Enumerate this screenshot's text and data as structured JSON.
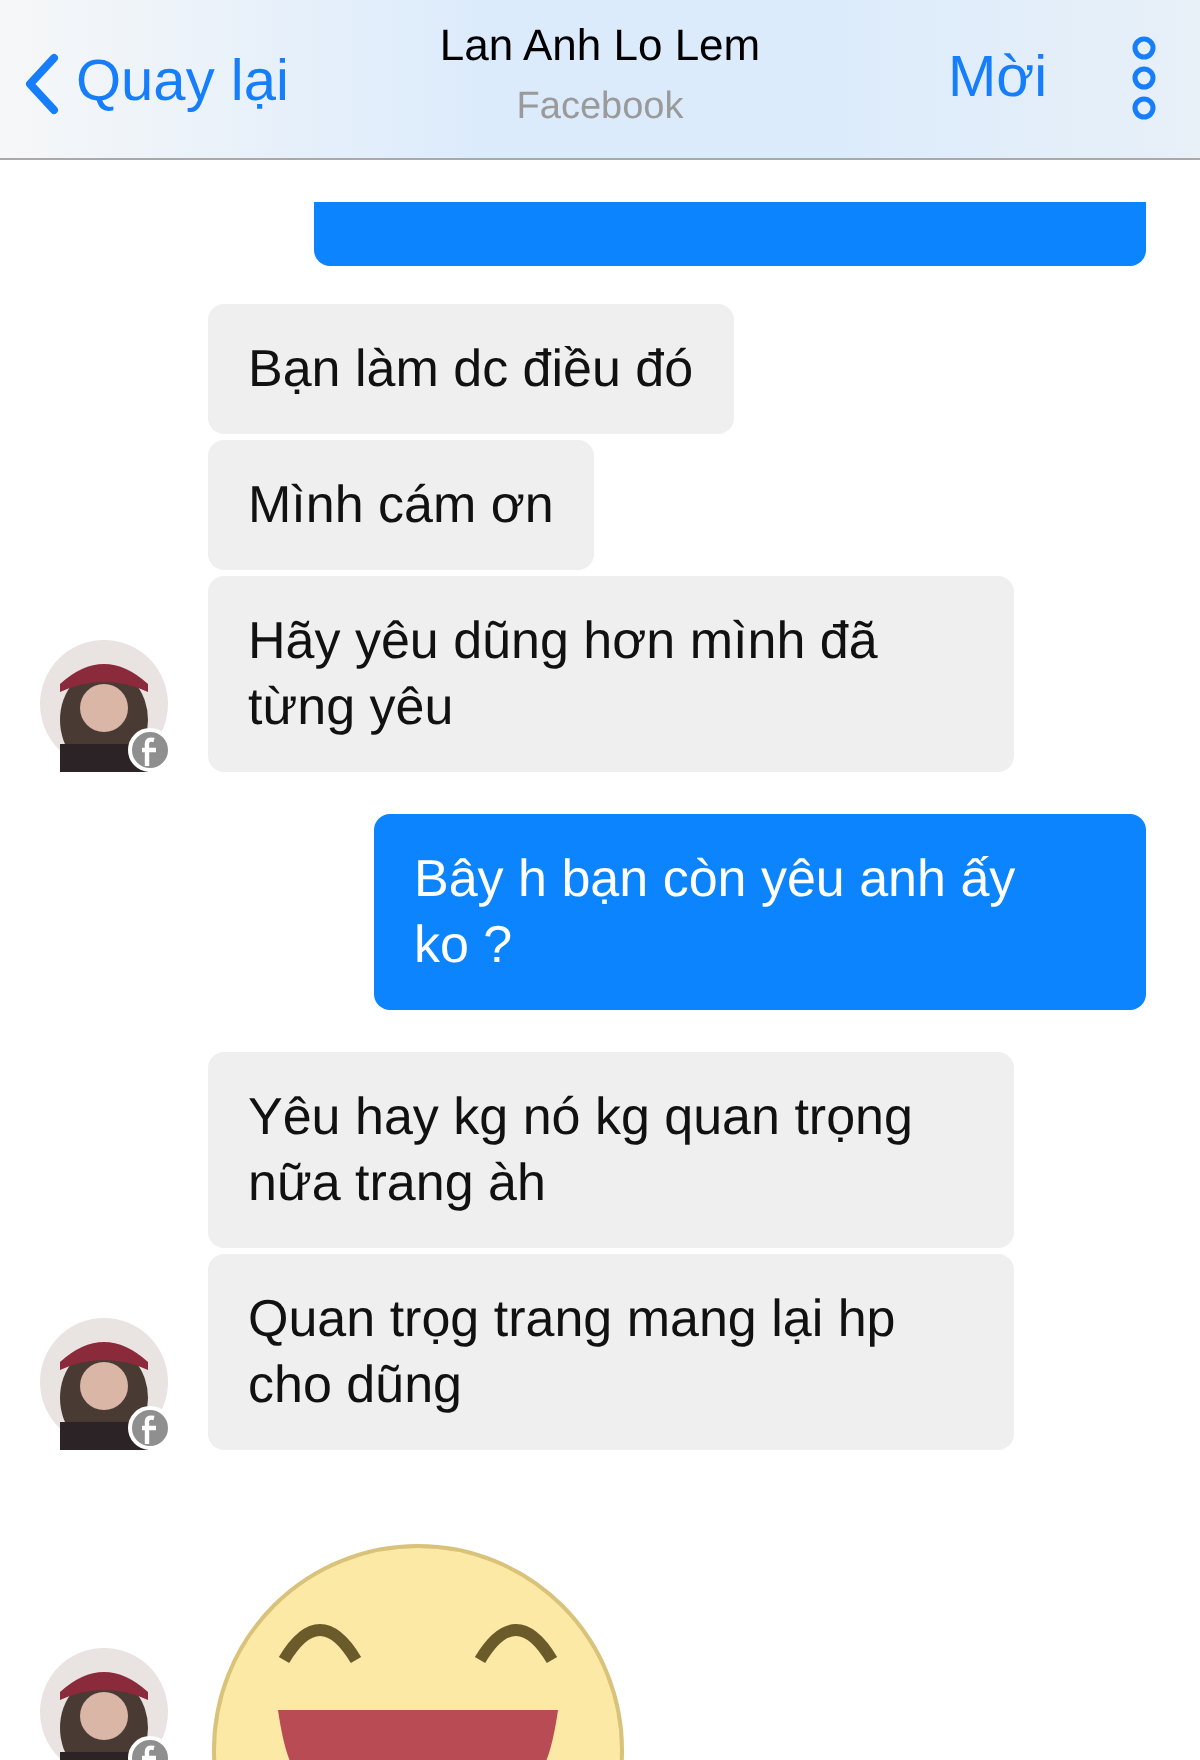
{
  "header": {
    "back": "Quay lại",
    "title": "Lan Anh Lo Lem",
    "subtitle": "Facebook",
    "invite": "Mời"
  },
  "groups": [
    {
      "outgoing": true,
      "messages": [
        {
          "kind": "cut"
        }
      ]
    },
    {
      "outgoing": false,
      "messages": [
        {
          "kind": "text",
          "text": "Bạn làm dc điều đó"
        },
        {
          "kind": "text",
          "text": "Mình cám ơn"
        },
        {
          "kind": "text",
          "text": "Hãy yêu dũng hơn mình đã từng yêu"
        }
      ]
    },
    {
      "outgoing": true,
      "messages": [
        {
          "kind": "text",
          "text": "Bây h bạn còn yêu anh ấy ko ?"
        }
      ]
    },
    {
      "outgoing": false,
      "messages": [
        {
          "kind": "text",
          "text": "Yêu hay kg nó kg quan trọng nữa trang àh"
        },
        {
          "kind": "text",
          "text": "Quan trọg  trang mang lại hp cho dũng"
        }
      ]
    },
    {
      "outgoing": false,
      "messages": [
        {
          "kind": "sticker"
        }
      ]
    }
  ]
}
